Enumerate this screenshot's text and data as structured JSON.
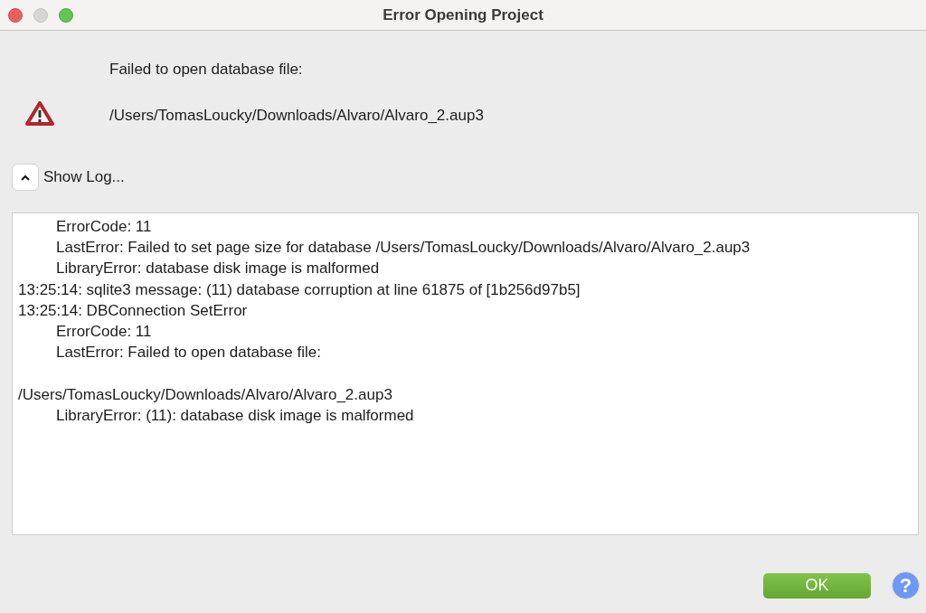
{
  "window": {
    "title": "Error Opening Project"
  },
  "message": [
    "Failed to open database file:",
    "/Users/TomasLoucky/Downloads/Alvaro/Alvaro_2.aup3"
  ],
  "log_toggle": {
    "label": "Show Log...",
    "expanded": true
  },
  "log": [
    {
      "kind": "indented",
      "text": "ErrorCode: 11"
    },
    {
      "kind": "indented",
      "text": "LastError: Failed to set page size for database /Users/TomasLoucky/Downloads/Alvaro/Alvaro_2.aup3"
    },
    {
      "kind": "indented",
      "text": "LibraryError: database disk image is malformed"
    },
    {
      "kind": "plain",
      "text": "13:25:14: sqlite3 message: (11) database corruption at line 61875 of [1b256d97b5]"
    },
    {
      "kind": "plain",
      "text": "13:25:14: DBConnection SetError"
    },
    {
      "kind": "indented",
      "text": "ErrorCode: 11"
    },
    {
      "kind": "indented",
      "text": "LastError: Failed to open database file:"
    },
    {
      "kind": "gap"
    },
    {
      "kind": "plain",
      "text": "/Users/TomasLoucky/Downloads/Alvaro/Alvaro_2.aup3"
    },
    {
      "kind": "indented",
      "text": "LibraryError: (11): database disk image is malformed"
    }
  ],
  "buttons": {
    "ok": "OK",
    "help": "?"
  }
}
